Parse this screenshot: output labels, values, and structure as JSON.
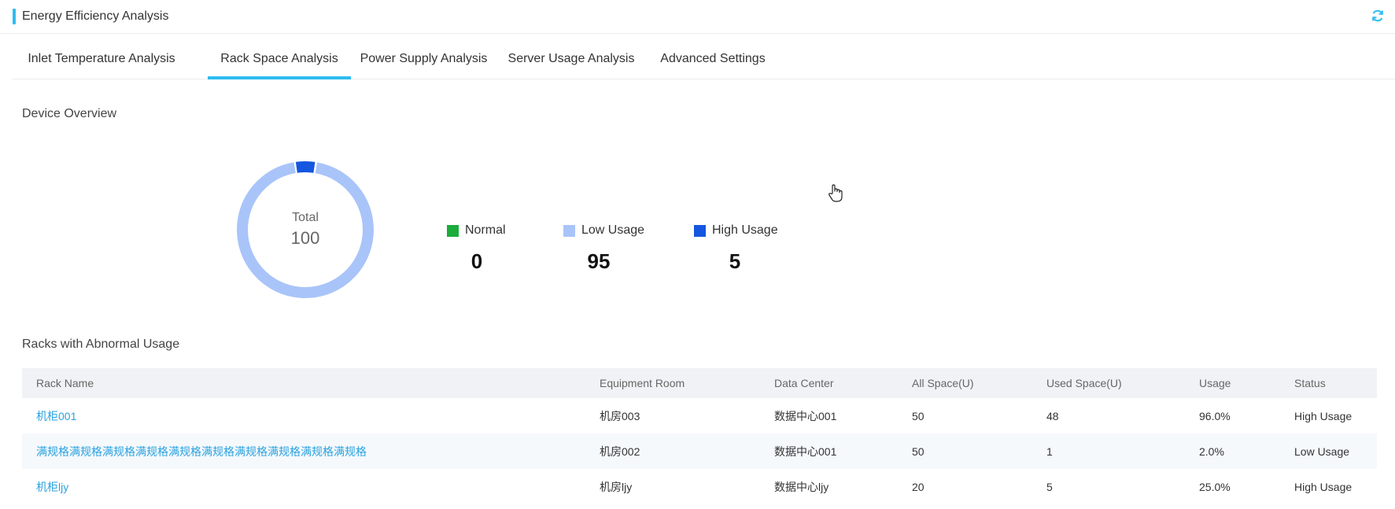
{
  "header": {
    "title": "Energy Efficiency Analysis",
    "refresh_icon": "refresh-icon",
    "accent_color": "#2dbdf0"
  },
  "tabs": [
    {
      "label": "Inlet Temperature Analysis",
      "active": false
    },
    {
      "label": "Rack Space Analysis",
      "active": true
    },
    {
      "label": "Power Supply Analysis",
      "active": false
    },
    {
      "label": "Server Usage Analysis",
      "active": false
    },
    {
      "label": "Advanced Settings",
      "active": false
    }
  ],
  "overview": {
    "title": "Device Overview",
    "total_label": "Total",
    "total_value": "100",
    "legend": [
      {
        "label": "Normal",
        "value": "0",
        "color": "#1aad3a"
      },
      {
        "label": "Low Usage",
        "value": "95",
        "color": "#a9c4f9"
      },
      {
        "label": "High Usage",
        "value": "5",
        "color": "#1556e0"
      }
    ]
  },
  "abnormal": {
    "title": "Racks with Abnormal Usage",
    "columns": [
      "Rack Name",
      "Equipment Room",
      "Data Center",
      "All Space(U)",
      "Used Space(U)",
      "Usage",
      "Status"
    ],
    "rows": [
      [
        "机柜001",
        "机房003",
        "数据中心001",
        "50",
        "48",
        "96.0%",
        "High Usage"
      ],
      [
        "满规格满规格满规格满规格满规格满规格满规格满规格满规格满规格",
        "机房002",
        "数据中心001",
        "50",
        "1",
        "2.0%",
        "Low Usage"
      ],
      [
        "机柜ljy",
        "机房ljy",
        "数据中心ljy",
        "20",
        "5",
        "25.0%",
        "High Usage"
      ]
    ]
  }
}
